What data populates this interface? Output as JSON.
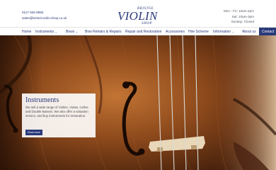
{
  "header": {
    "phone": "0117 925 9990",
    "email": "sales@bristol-violin-shop.co.uk",
    "logo": {
      "top": "BRISTOL",
      "main": "VIOLIN",
      "bottom": "SHOP"
    },
    "hours": [
      "Mon - Fri: 10am-4pm",
      "Sat: 10am-3pm",
      "Sunday: Closed"
    ]
  },
  "nav": {
    "items": [
      {
        "label": "Home",
        "dropdown": false
      },
      {
        "label": "Instruments",
        "dropdown": true
      },
      {
        "label": "Bows",
        "dropdown": true
      },
      {
        "label": "Bow Rehairs & Repairs",
        "dropdown": false
      },
      {
        "label": "Repair and Restoration",
        "dropdown": false
      },
      {
        "label": "Accessories",
        "dropdown": false
      },
      {
        "label": "Hire Scheme",
        "dropdown": false
      },
      {
        "label": "Information",
        "dropdown": true
      },
      {
        "label": "About us",
        "dropdown": false
      }
    ],
    "contact_label": "Contact"
  },
  "hero": {
    "title": "Instruments",
    "text": "We sell a wide range of Violins, Violas, Cellos and Double Basses. We also offer a valuation service, and buy instruments for restoration.",
    "button": "Read more"
  },
  "colors": {
    "brand": "#2a3a7a",
    "wood": "#8a4a1e"
  }
}
